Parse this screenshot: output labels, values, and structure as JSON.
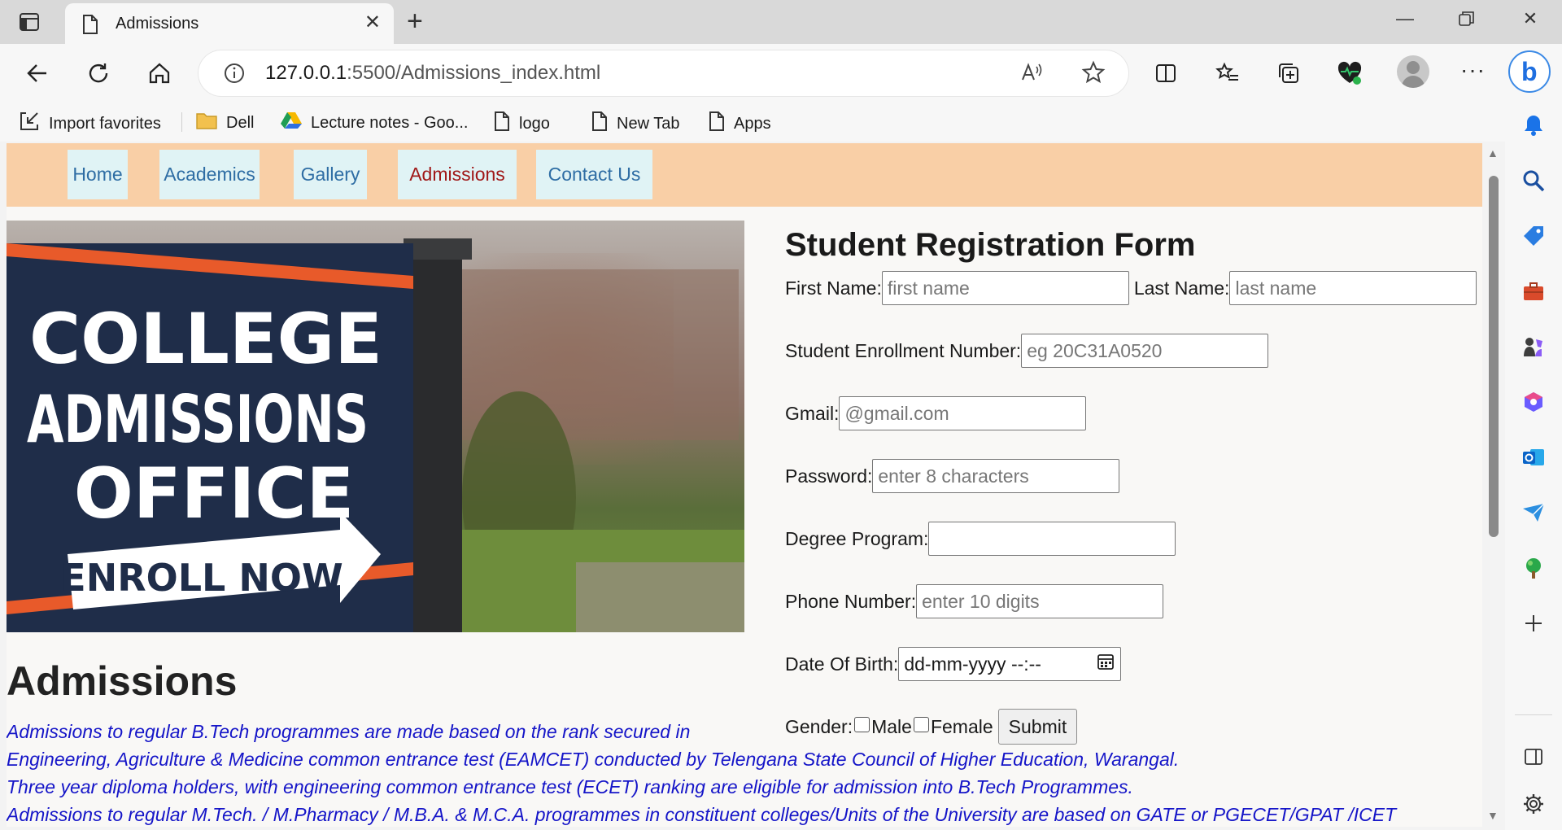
{
  "tab": {
    "title": "Admissions",
    "close": "✕",
    "new_tab": "+"
  },
  "window": {
    "minimize": "—",
    "close": "✕"
  },
  "address": {
    "host": "127.0.0.1",
    "path": ":5500/Admissions_index.html",
    "read_aloud": "Ȃ"
  },
  "toolbar": {
    "more": "···"
  },
  "bing": {
    "label": "b"
  },
  "favorites": [
    {
      "label": "Import favorites",
      "icon": "import-icon"
    },
    {
      "label": "Dell",
      "icon": "folder-icon"
    },
    {
      "label": "Lecture notes - Goo...",
      "icon": "google-drive-icon"
    },
    {
      "label": "logo",
      "icon": "page-icon"
    },
    {
      "label": "New Tab",
      "icon": "page-icon"
    },
    {
      "label": "Apps",
      "icon": "page-icon"
    }
  ],
  "nav": {
    "items": [
      {
        "label": "Home"
      },
      {
        "label": "Academics"
      },
      {
        "label": "Gallery"
      },
      {
        "label": "Admissions"
      },
      {
        "label": "Contact Us"
      }
    ],
    "active": "Admissions"
  },
  "hero": {
    "line1": "COLLEGE",
    "line2": "ADMISSIONS",
    "line3": "OFFICE",
    "arrow_text": "ENROLL NOW"
  },
  "admissions": {
    "title": "Admissions",
    "lines": [
      "Admissions to regular B.Tech programmes are made based on the rank secured in",
      "Engineering, Agriculture & Medicine common entrance test (EAMCET) conducted by Telengana State Council of Higher Education, Warangal.",
      "Three year diploma holders, with engineering common entrance test (ECET) ranking are eligible for admission into B.Tech Programmes.",
      "Admissions to regular M.Tech. / M.Pharmacy / M.B.A. & M.C.A. programmes in constituent colleges/Units of the University are based on GATE or PGECET/GPAT /ICET"
    ]
  },
  "form": {
    "title": "Student Registration Form",
    "first_name_label": "First Name:",
    "first_name_placeholder": "first name",
    "last_name_label": "Last Name:",
    "last_name_placeholder": "last name",
    "enrollment_label": "Student Enrollment Number:",
    "enrollment_placeholder": "eg 20C31A0520",
    "gmail_label": "Gmail:",
    "gmail_placeholder": "@gmail.com",
    "password_label": "Password:",
    "password_placeholder": "enter 8 characters",
    "degree_label": "Degree Program:",
    "degree_placeholder": "",
    "phone_label": "Phone Number:",
    "phone_placeholder": "enter 10 digits",
    "dob_label": "Date Of Birth:",
    "dob_value": "dd-mm-yyyy  --:--",
    "gender_label": "Gender:",
    "male_label": "Male",
    "female_label": "Female",
    "submit_label": "Submit"
  },
  "colors": {
    "nav_bg": "#f9cfa6",
    "nav_item_bg": "#e0f3f5",
    "nav_link": "#2e6da4",
    "nav_active": "#a01818",
    "admissions_text": "#1515c8"
  }
}
